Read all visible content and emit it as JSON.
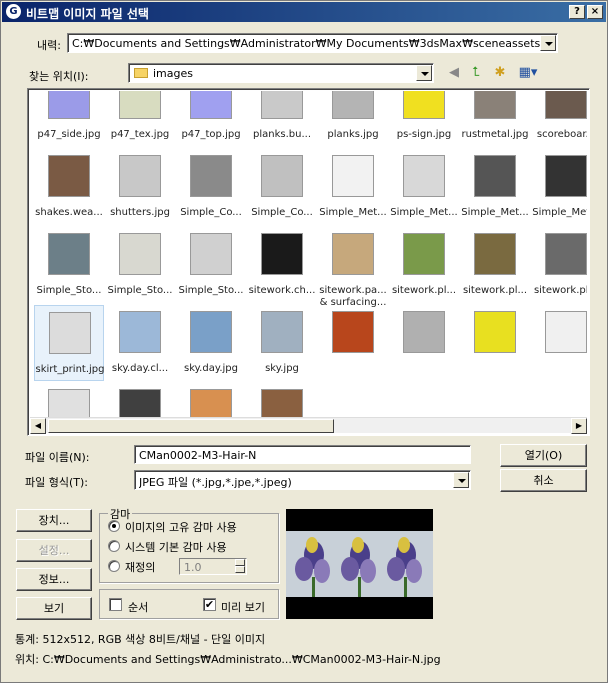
{
  "window": {
    "title": "비트맵 이미지 파일 선택",
    "help_glyph": "?",
    "close_glyph": "×"
  },
  "history": {
    "label": "내력:",
    "value": "C:₩Documents and Settings₩Administrator₩My Documents₩3dsMax₩sceneassets₩images"
  },
  "lookin": {
    "label": "찾는 위치(I):",
    "value": "images"
  },
  "files": [
    {
      "label": "p47_side.jpg",
      "color": "#9b9be8"
    },
    {
      "label": "p47_tex.jpg",
      "color": "#d8dcc0"
    },
    {
      "label": "p47_top.jpg",
      "color": "#a0a0f0"
    },
    {
      "label": "planks.bu...",
      "color": "#c9c9c9"
    },
    {
      "label": "planks.jpg",
      "color": "#b4b4b4"
    },
    {
      "label": "ps-sign.jpg",
      "color": "#f0e020"
    },
    {
      "label": "rustmetal.jpg",
      "color": "#8a8178"
    },
    {
      "label": "scoreboar...",
      "color": "#6b5a4e"
    },
    {
      "label": "shakes.wea...",
      "color": "#7a5a44"
    },
    {
      "label": "shutters.jpg",
      "color": "#c8c8c8"
    },
    {
      "label": "Simple_Co...",
      "color": "#8a8a8a"
    },
    {
      "label": "Simple_Co...",
      "color": "#c0c0c0"
    },
    {
      "label": "Simple_Met...",
      "color": "#f2f2f2"
    },
    {
      "label": "Simple_Met...",
      "color": "#d8d8d8"
    },
    {
      "label": "Simple_Met...",
      "color": "#555555"
    },
    {
      "label": "Simple_Met...",
      "color": "#333333"
    },
    {
      "label": "Simple_Sto...",
      "color": "#6c7f88"
    },
    {
      "label": "Simple_Sto...",
      "color": "#d8d8d0"
    },
    {
      "label": "Simple_Sto...",
      "color": "#d0d0d0"
    },
    {
      "label": "sitework.ch...",
      "color": "#1a1a1a"
    },
    {
      "label": "sitework.pa... & surfacing...",
      "color": "#c6a87c"
    },
    {
      "label": "sitework.pl...",
      "color": "#7a9a4a"
    },
    {
      "label": "sitework.pl...",
      "color": "#7a6a40"
    },
    {
      "label": "sitework.pl...",
      "color": "#6a6a6a"
    },
    {
      "label": "skirt_print.jpg",
      "color": "#dcdcdc"
    },
    {
      "label": "sky.day.cl...",
      "color": "#9cb8d8"
    },
    {
      "label": "sky.day.jpg",
      "color": "#7aa0c8"
    },
    {
      "label": "sky.jpg",
      "color": "#a0b0c0"
    },
    {
      "label": "",
      "color": "#b8461c"
    },
    {
      "label": "",
      "color": "#b0b0b0"
    },
    {
      "label": "",
      "color": "#e8e020"
    },
    {
      "label": "",
      "color": "#f0f0f0"
    },
    {
      "label": "",
      "color": "#e0e0e0"
    },
    {
      "label": "",
      "color": "#404040"
    },
    {
      "label": "",
      "color": "#d89050"
    },
    {
      "label": "",
      "color": "#8a6040"
    }
  ],
  "filename": {
    "label": "파일 이름(N):",
    "value": "CMan0002-M3-Hair-N"
  },
  "filetype": {
    "label": "파일 형식(T):",
    "value": "JPEG 파일 (*.jpg,*.jpe,*.jpeg)"
  },
  "buttons": {
    "open": "열기(O)",
    "cancel": "취소",
    "devices": "장치...",
    "setup": "설정...",
    "info": "정보...",
    "view": "보기"
  },
  "gamma": {
    "title": "감마",
    "options": [
      "이미지의 고유 감마 사용",
      "시스템 기본 감마 사용",
      "재정의"
    ],
    "selected": 0,
    "override_value": "1.0"
  },
  "options": {
    "sequence_label": "순서",
    "sequence_checked": false,
    "preview_label": "미리 보기",
    "preview_checked": true
  },
  "status": {
    "stats": "통계: 512x512, RGB 색상 8비트/채널 - 단일 이미지",
    "location": "위치: C:₩Documents and Settings₩Administrato...₩CMan0002-M3-Hair-N.jpg"
  }
}
